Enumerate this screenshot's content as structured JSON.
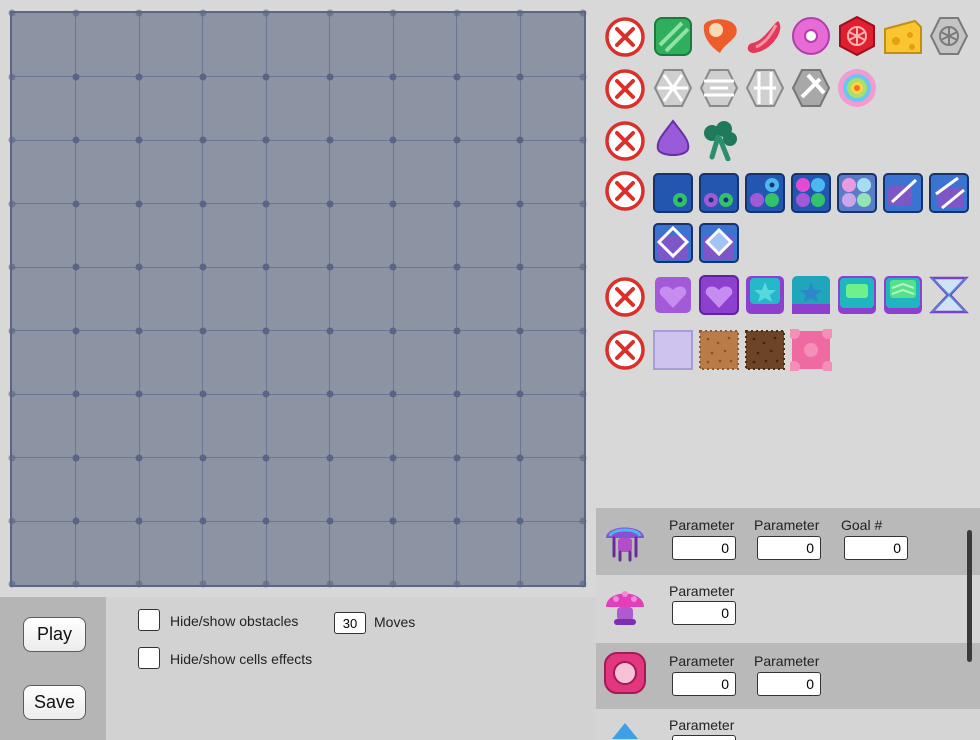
{
  "board": {
    "rows": 9,
    "cols": 9
  },
  "controls": {
    "play_label": "Play",
    "save_label": "Save",
    "hide_obstacles_label": "Hide/show obstacles",
    "hide_cells_effects_label": "Hide/show cells effects",
    "moves_value": "30",
    "moves_label": "Moves"
  },
  "palette": {
    "rows": [
      {
        "tiles": [
          "green-candy-icon",
          "meat-icon",
          "sausage-icon",
          "donut-icon",
          "red-hex-candy-icon",
          "cheese-icon",
          "grey-hex-icon"
        ]
      },
      {
        "tiles": [
          "wheel-blocker-1-icon",
          "wheel-blocker-2-icon",
          "wheel-blocker-3-icon",
          "wheel-blocker-4-icon",
          "rainbow-ball-icon"
        ]
      },
      {
        "tiles": [
          "purple-egg-icon",
          "broccoli-icon"
        ]
      },
      {
        "tiles": [
          "blue-box-1-icon",
          "blue-box-2-icon",
          "blue-box-3-icon",
          "blue-box-4-icon",
          "blue-box-5-icon",
          "blue-box-diagonal-1-icon",
          "blue-box-diagonal-2-icon",
          "blue-box-diagonal-3-icon",
          "blue-box-diagonal-4-icon"
        ]
      },
      {
        "tiles": [
          "purple-heart-1-icon",
          "purple-heart-2-icon",
          "teal-star-1-icon",
          "teal-star-2-icon",
          "teal-cake-1-icon",
          "teal-cake-2-icon",
          "hourglass-icon"
        ]
      },
      {
        "tiles": [
          "lavender-cell-icon",
          "cookie-light-icon",
          "cookie-dark-icon",
          "pink-pattern-icon"
        ]
      }
    ],
    "remove_icon": "red-x-circle-icon"
  },
  "params": {
    "rows": [
      {
        "icon": "jellyfish-mushroom-icon",
        "fields": [
          {
            "label": "Parameter",
            "value": "0"
          },
          {
            "label": "Parameter",
            "value": "0"
          },
          {
            "label": "Goal #",
            "value": "0"
          }
        ]
      },
      {
        "icon": "pink-mushroom-icon",
        "fields": [
          {
            "label": "Parameter",
            "value": "0"
          }
        ]
      },
      {
        "icon": "pink-ring-icon",
        "fields": [
          {
            "label": "Parameter",
            "value": "0"
          },
          {
            "label": "Parameter",
            "value": "0"
          }
        ]
      },
      {
        "icon": "blue-drop-icon",
        "fields": [
          {
            "label": "Parameter",
            "value": ""
          }
        ]
      }
    ]
  },
  "colors": {
    "board": "#8c93a3",
    "grid": "#6c7692",
    "remove": "#d9302c"
  }
}
